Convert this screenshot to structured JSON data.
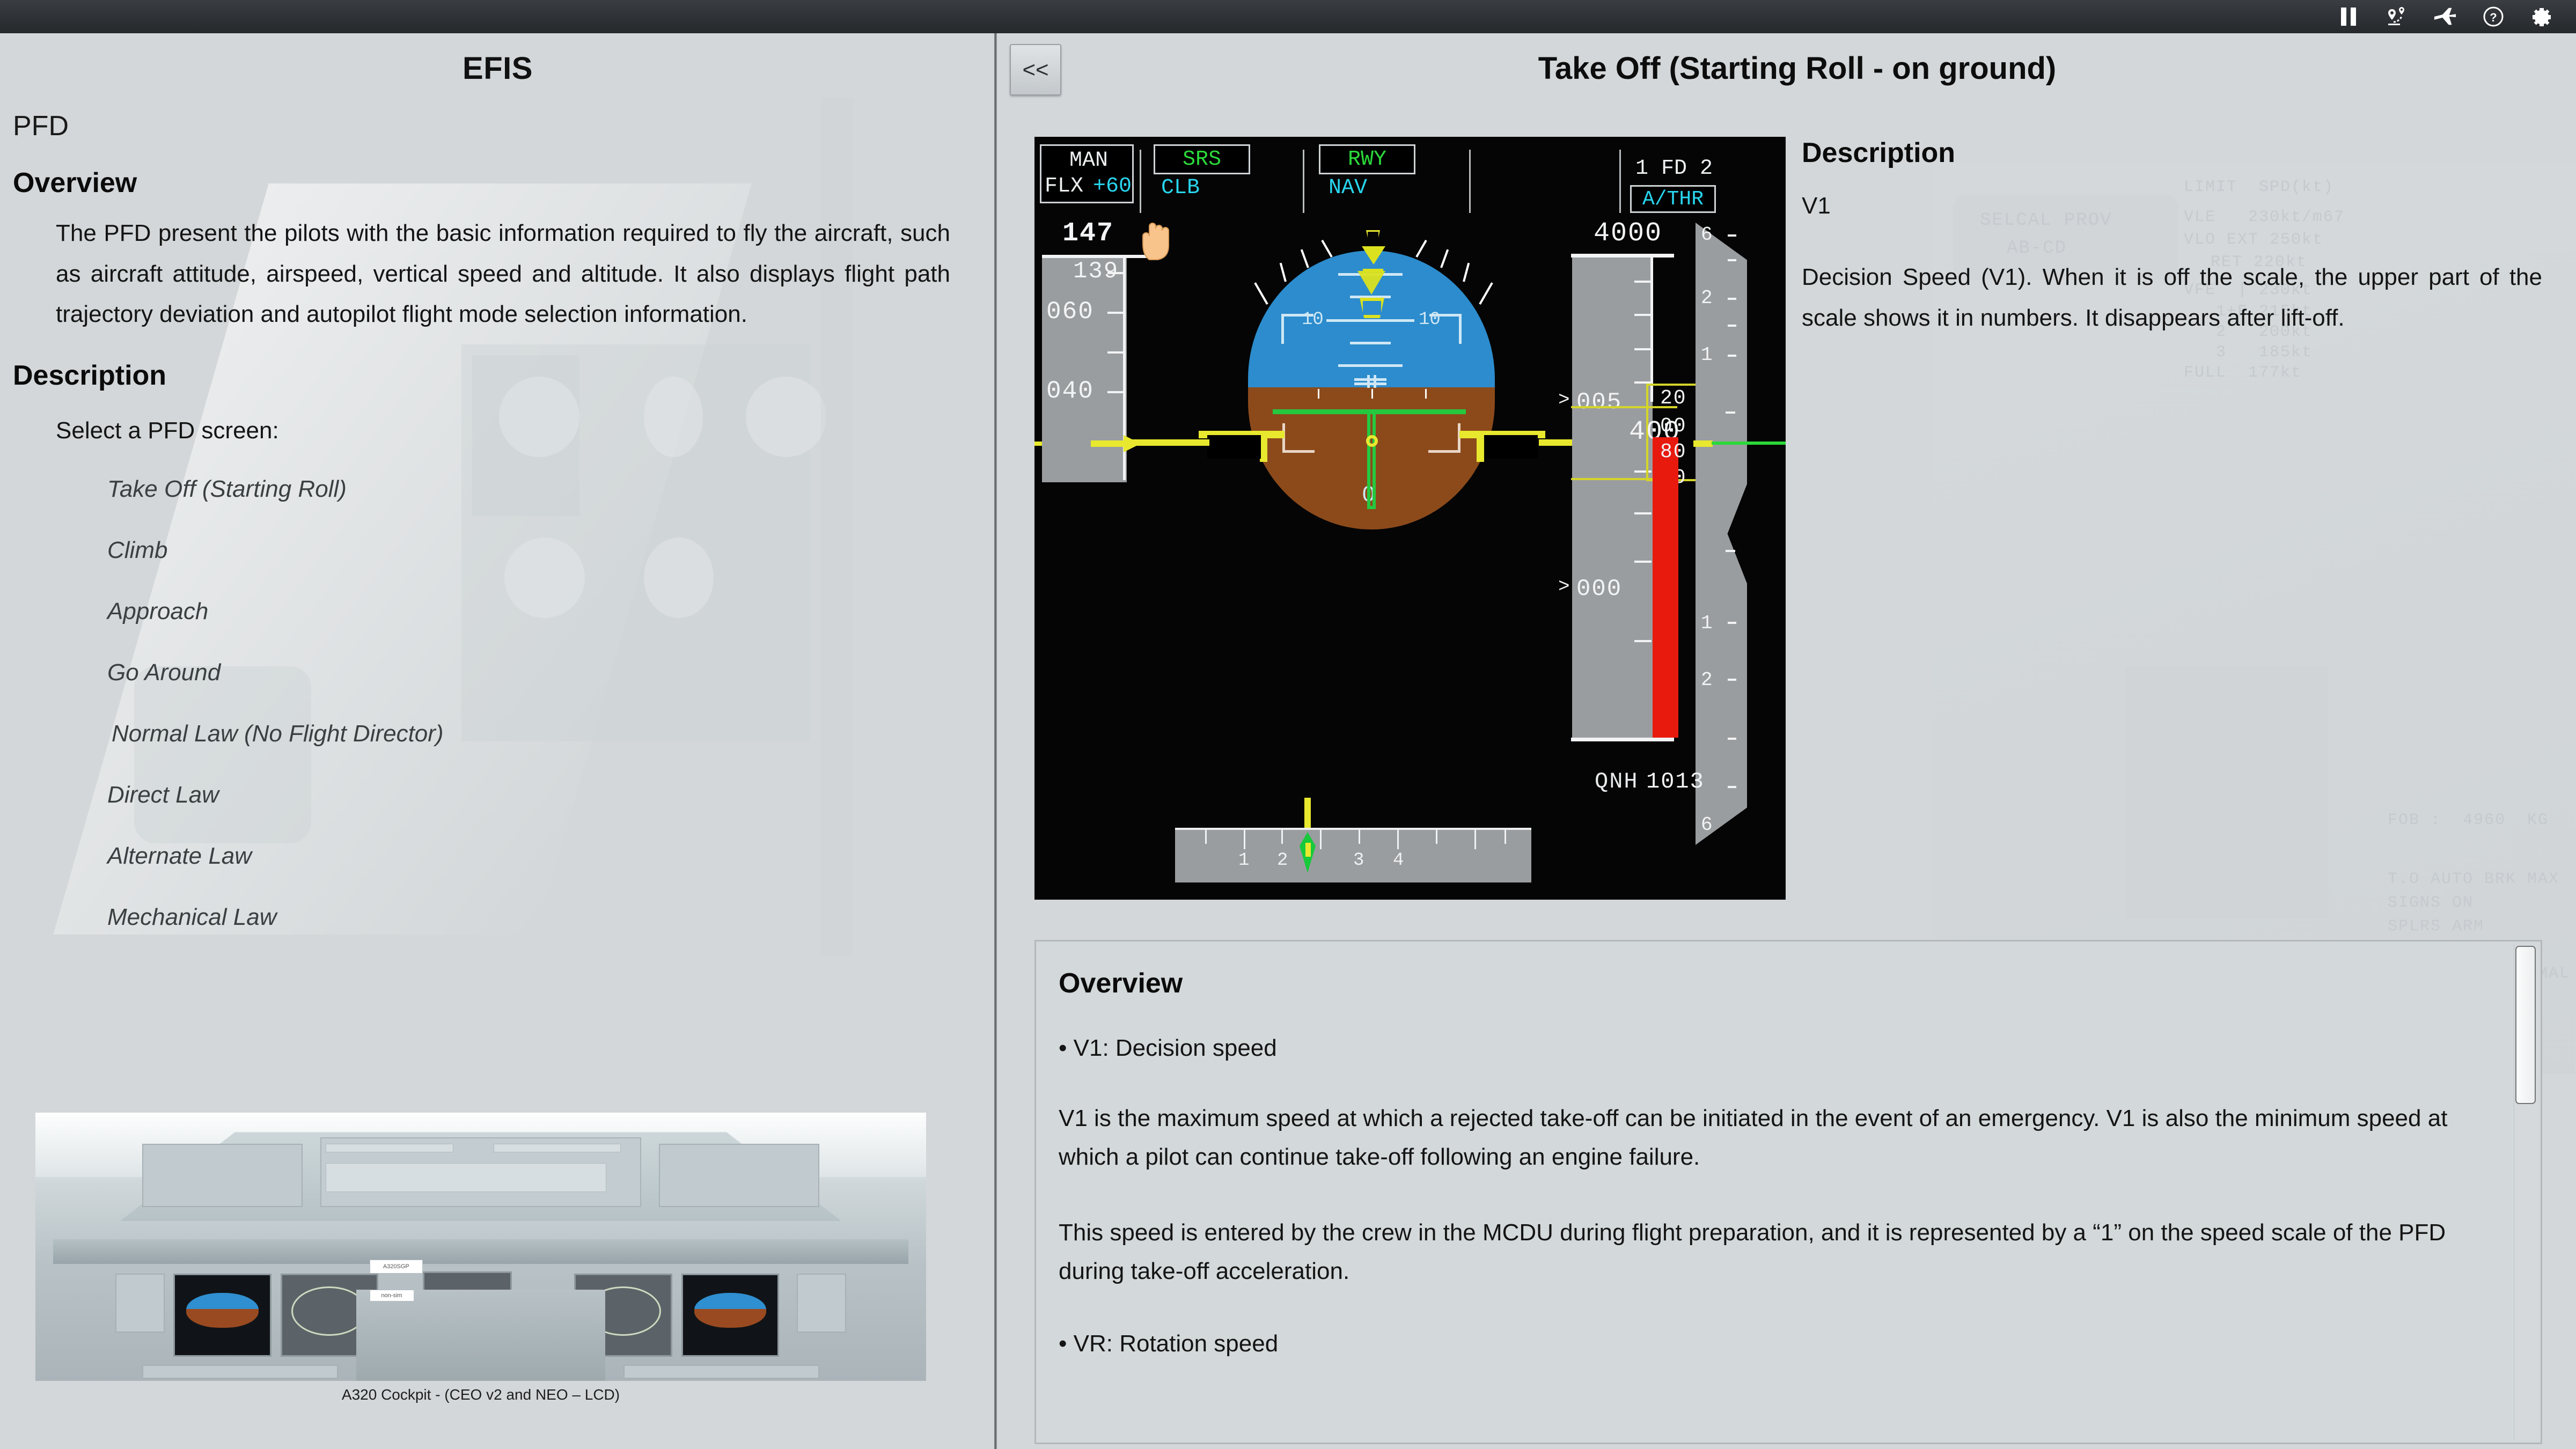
{
  "titlebar": {
    "icons": [
      {
        "name": "pause-icon",
        "label": "Pause"
      },
      {
        "name": "route-map-icon",
        "label": "Route"
      },
      {
        "name": "airplane-icon",
        "label": "Aircraft"
      },
      {
        "name": "help-icon",
        "label": "Help"
      },
      {
        "name": "settings-gear-icon",
        "label": "Settings"
      }
    ]
  },
  "left": {
    "title": "EFIS",
    "subtitle": "PFD",
    "overview_heading": "Overview",
    "overview_text": "The PFD present the pilots with the basic information required to fly the aircraft, such as aircraft attitude, airspeed, vertical speed and altitude. It also displays flight path trajectory deviation and autopilot flight mode selection information.",
    "description_heading": "Description",
    "select_label": "Select a PFD screen:",
    "screens": [
      "Take Off (Starting Roll)",
      "Climb",
      "Approach",
      "Go Around",
      "Normal Law (No Flight Director)",
      "Direct Law",
      "Alternate Law",
      "Mechanical Law"
    ],
    "cockpit_caption": "A320 Cockpit - (CEO v2 and NEO – LCD)",
    "cockpit_tag_1": "A320SGP",
    "cockpit_tag_2": "non-sim"
  },
  "right": {
    "collapse_label": "<<",
    "title": "Take Off (Starting Roll - on ground)",
    "description_heading": "Description",
    "description_subject": "V1",
    "description_body": "Decision Speed (V1). When it is off the scale, the upper part of the scale shows it in numbers. It disappears after lift-off.",
    "overview_heading": "Overview",
    "overview_bullet": "• V1: Decision speed",
    "overview_para_1": "V1 is the maximum speed at which a rejected take-off can be initiated in the event of an emergency. V1 is also the minimum speed at which a pilot can continue take-off following an engine failure.",
    "overview_para_2": "This speed is entered by the crew in the MCDU during flight preparation, and it is represented by a “1” on the speed scale of the PFD during take-off acceleration.",
    "overview_cut_line": "• VR: Rotation speed"
  },
  "pfd": {
    "fma": {
      "col1_boxed": "MAN",
      "col1_line2_left": "FLX",
      "col1_line2_right": "+60",
      "col2_boxed": "SRS",
      "col2_line2": "CLB",
      "col3_boxed": "RWY",
      "col3_line2": "NAV",
      "col5_line1": "1 FD 2",
      "col5_boxed": "A/THR"
    },
    "speed": {
      "v1_value": "147",
      "target_value": "139",
      "ticks": [
        "060",
        "040"
      ]
    },
    "altitude": {
      "selected": "4000",
      "ticks": [
        "005",
        "000"
      ],
      "readout": "400",
      "readout_small_top": "20",
      "readout_small_mid": "00",
      "readout_small_red": "80",
      "readout_small_bottom": "60"
    },
    "vsi_ticks": [
      "6",
      "2",
      "1",
      "1",
      "2",
      "6"
    ],
    "pitch_labels": [
      "10",
      "10"
    ],
    "heading_value": "0",
    "qnh_label": "QNH",
    "qnh_value": "1013",
    "runway_numbers": [
      "1",
      "2",
      "3",
      "4"
    ]
  },
  "colors": {
    "sky": "#2c8ccd",
    "ground": "#8c4a1b",
    "green": "#2bd93a",
    "cyan": "#29d6ef",
    "magenta": "#ee4fe0",
    "yellow": "#e8e82e",
    "red": "#e81a0e",
    "panel_bg": "#d3d7d9"
  }
}
